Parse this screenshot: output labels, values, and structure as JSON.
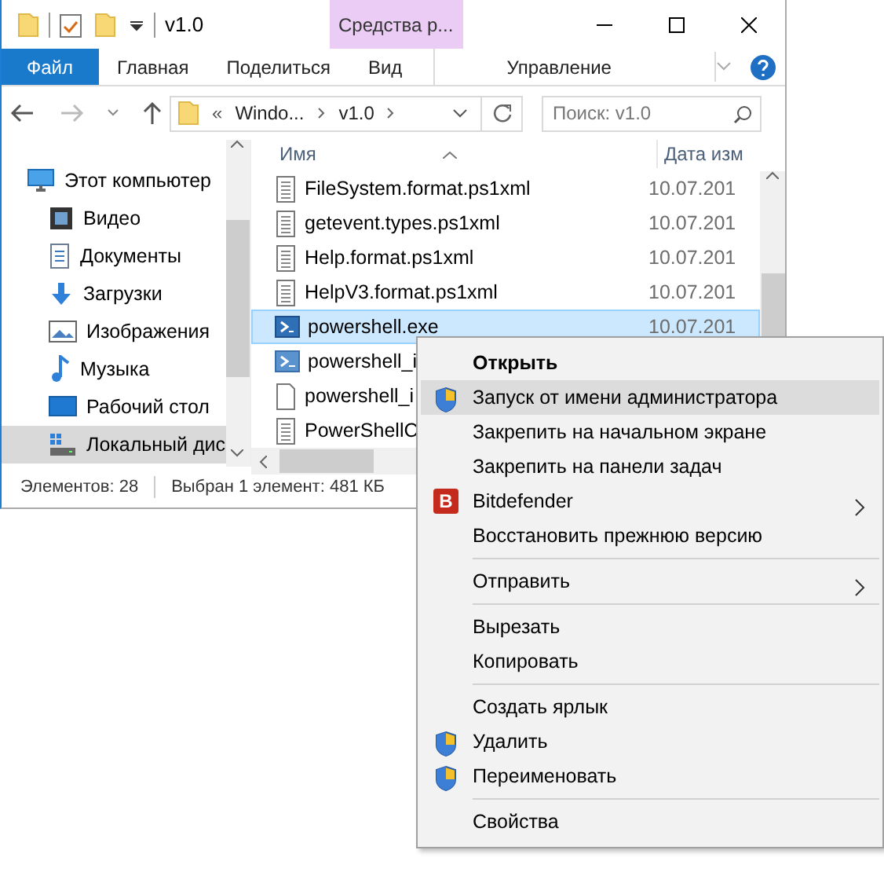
{
  "window": {
    "title": "v1.0",
    "contextual_tab": "Средства р..."
  },
  "ribbon_tabs": [
    {
      "label": "Файл",
      "kind": "file"
    },
    {
      "label": "Главная",
      "kind": "tab"
    },
    {
      "label": "Поделиться",
      "kind": "tab"
    },
    {
      "label": "Вид",
      "kind": "tab"
    },
    {
      "label": "Управление",
      "kind": "contextual"
    }
  ],
  "address_bar": {
    "overflow": "«",
    "segments": [
      "Windo...",
      "v1.0"
    ]
  },
  "search": {
    "placeholder": "Поиск: v1.0"
  },
  "nav_pane": {
    "items": [
      {
        "label": "Этот компьютер",
        "kind": "computer",
        "selected": false,
        "children": [
          {
            "label": "Видео",
            "kind": "video",
            "selected": false
          },
          {
            "label": "Документы",
            "kind": "documents",
            "selected": false
          },
          {
            "label": "Загрузки",
            "kind": "downloads",
            "selected": false
          },
          {
            "label": "Изображения",
            "kind": "images",
            "selected": false
          },
          {
            "label": "Музыка",
            "kind": "music",
            "selected": false
          },
          {
            "label": "Рабочий стол",
            "kind": "desktop",
            "selected": false
          },
          {
            "label": "Локальный дис",
            "kind": "drive",
            "selected": true
          }
        ]
      }
    ]
  },
  "file_list": {
    "columns": [
      "Имя",
      "Дата изм"
    ],
    "rows": [
      {
        "name": "FileSystem.format.ps1xml",
        "date": "10.07.201",
        "kind": "document",
        "selected": false
      },
      {
        "name": "getevent.types.ps1xml",
        "date": "10.07.201",
        "kind": "document",
        "selected": false
      },
      {
        "name": "Help.format.ps1xml",
        "date": "10.07.201",
        "kind": "document",
        "selected": false
      },
      {
        "name": "HelpV3.format.ps1xml",
        "date": "10.07.201",
        "kind": "document",
        "selected": false
      },
      {
        "name": "powershell.exe",
        "date": "10.07.201",
        "kind": "console",
        "selected": true
      },
      {
        "name": "powershell_i",
        "kind": "console-ise",
        "selected": false
      },
      {
        "name": "powershell_i",
        "kind": "blank",
        "selected": false
      },
      {
        "name": "PowerShellC",
        "kind": "document",
        "selected": false
      }
    ]
  },
  "status_bar": {
    "item_count": "Элементов: 28",
    "selection": "Выбран 1 элемент: 481 КБ"
  },
  "context_menu": {
    "items": [
      {
        "kind": "item",
        "label": "Открыть",
        "default": true,
        "selected": false
      },
      {
        "kind": "shield",
        "label": "Запуск от имени администратора",
        "selected": true
      },
      {
        "kind": "item",
        "label": "Закрепить на начальном экране",
        "selected": false
      },
      {
        "kind": "item",
        "label": "Закрепить на панели задач",
        "selected": false
      },
      {
        "kind": "badge",
        "label": "Bitdefender",
        "icon_text": "B",
        "submenu": true,
        "selected": false
      },
      {
        "kind": "item",
        "label": "Восстановить прежнюю версию",
        "selected": false
      },
      {
        "kind": "separator"
      },
      {
        "kind": "item",
        "label": "Отправить",
        "submenu": true,
        "selected": false
      },
      {
        "kind": "separator"
      },
      {
        "kind": "item",
        "label": "Вырезать",
        "selected": false
      },
      {
        "kind": "item",
        "label": "Копировать",
        "selected": false
      },
      {
        "kind": "separator"
      },
      {
        "kind": "item",
        "label": "Создать ярлык",
        "selected": false
      },
      {
        "kind": "shield",
        "label": "Удалить",
        "selected": false
      },
      {
        "kind": "shield",
        "label": "Переименовать",
        "selected": false
      },
      {
        "kind": "separator"
      },
      {
        "kind": "item",
        "label": "Свойства",
        "selected": false
      }
    ]
  }
}
